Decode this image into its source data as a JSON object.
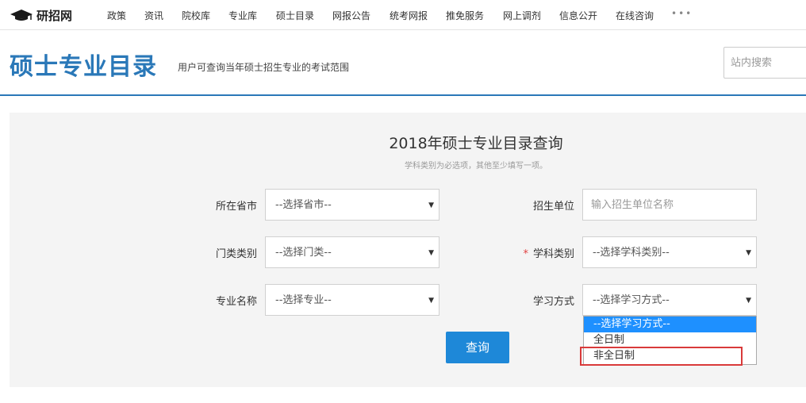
{
  "site": {
    "name": "研招网"
  },
  "nav": {
    "items": [
      "政策",
      "资讯",
      "院校库",
      "专业库",
      "硕士目录",
      "网报公告",
      "统考网报",
      "推免服务",
      "网上调剂",
      "信息公开",
      "在线咨询"
    ],
    "more": "•••"
  },
  "header": {
    "title": "硕士专业目录",
    "subtitle": "用户可查询当年硕士招生专业的考试范围",
    "search_placeholder": "站内搜索"
  },
  "form": {
    "title": "2018年硕士专业目录查询",
    "hint": "学科类别为必选项，其他至少填写一项。",
    "province": {
      "label": "所在省市",
      "value": "--选择省市--"
    },
    "unit": {
      "label": "招生单位",
      "placeholder": "输入招生单位名称"
    },
    "category": {
      "label": "门类类别",
      "value": "--选择门类--"
    },
    "discipline": {
      "label": "学科类别",
      "required_mark": "*",
      "value": "--选择学科类别--"
    },
    "major": {
      "label": "专业名称",
      "value": "--选择专业--"
    },
    "study_mode": {
      "label": "学习方式",
      "value": "--选择学习方式--",
      "options": [
        "--选择学习方式--",
        "全日制",
        "非全日制"
      ],
      "highlighted_option": "非全日制"
    },
    "query_button": "查询"
  },
  "icons": {
    "arrow": "▼"
  },
  "colors": {
    "accent": "#2a78b8",
    "button": "#1e88d8",
    "selected_option": "#1e90ff",
    "highlight": "#d93a3a"
  }
}
